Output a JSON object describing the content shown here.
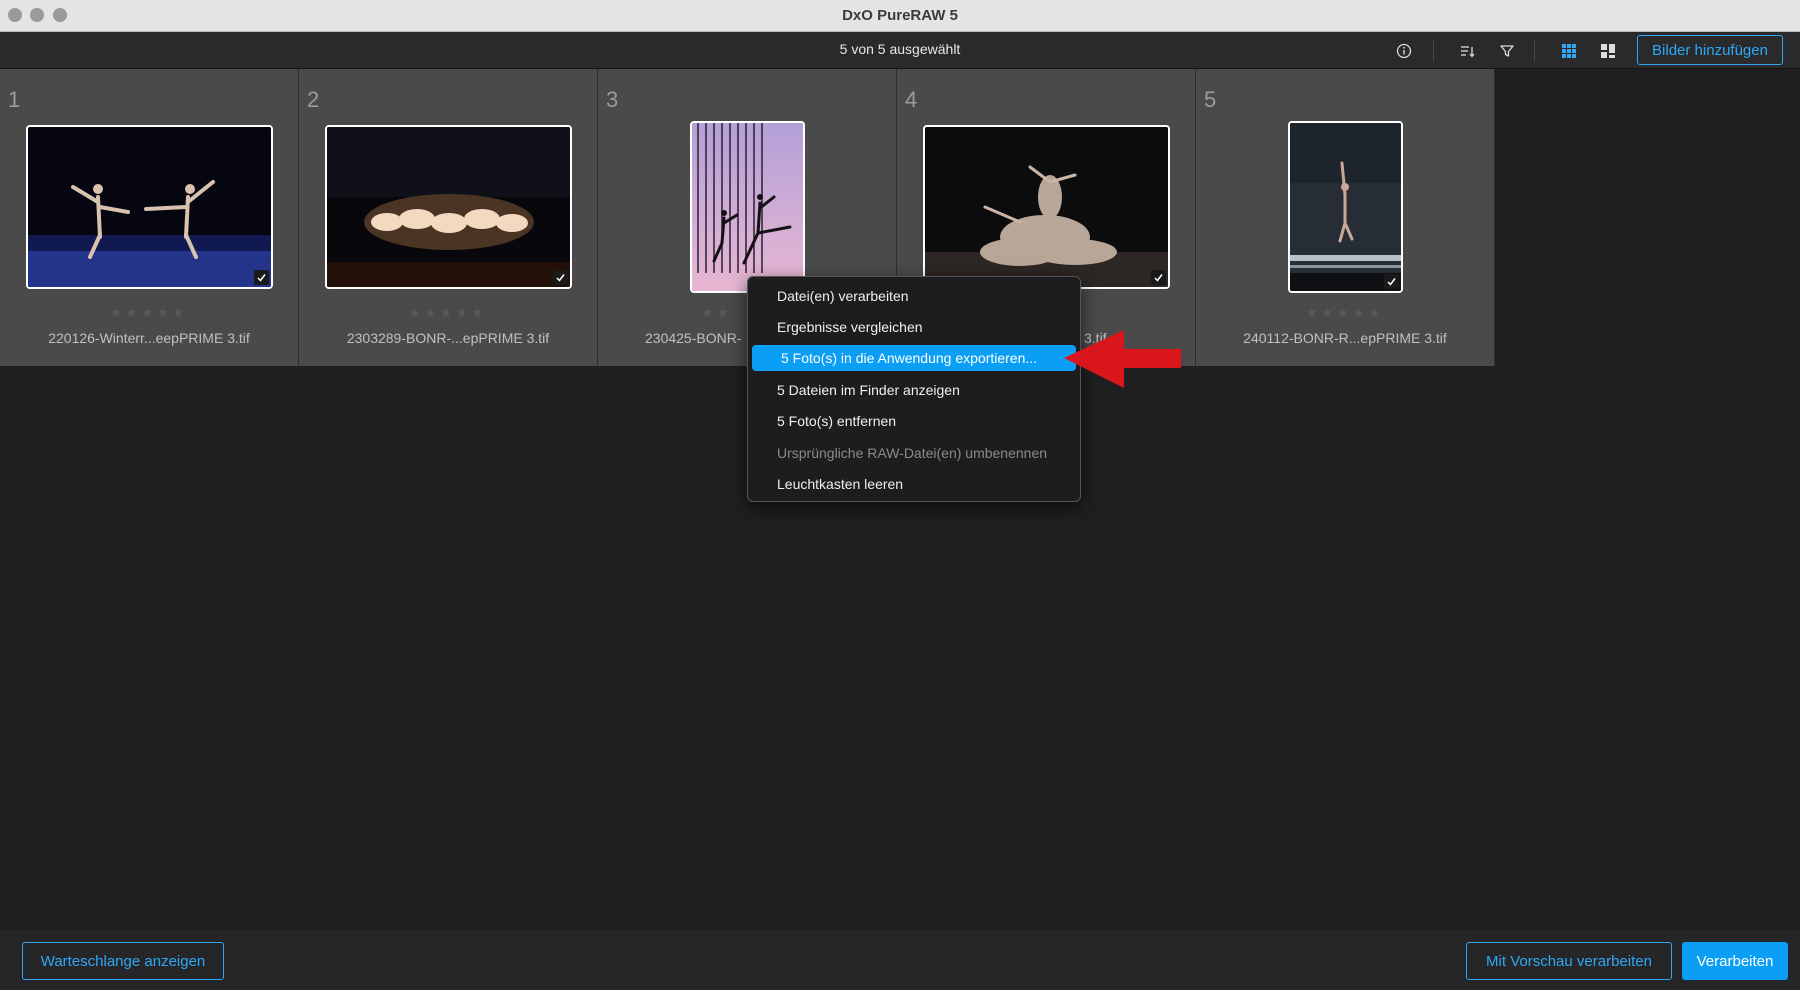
{
  "window": {
    "title": "DxO PureRAW 5"
  },
  "toolbar": {
    "selection_status": "5 von 5 ausgewählt",
    "icons": [
      "info-icon",
      "sort-icon",
      "filter-icon",
      "grid-view-icon",
      "compare-view-icon"
    ],
    "add_images_label": "Bilder hinzufügen"
  },
  "photos": [
    {
      "index": "1",
      "filename": "220126-Winterr...eepPRIME 3.tif",
      "stars": "★★★★★",
      "rating": 0,
      "selected": true
    },
    {
      "index": "2",
      "filename": "2303289-BONR-...epPRIME 3.tif",
      "stars": "★★★★★",
      "rating": 0,
      "selected": true
    },
    {
      "index": "3",
      "filename": "230425-BONR-",
      "stars": "★★",
      "rating": 0,
      "selected": true
    },
    {
      "index": "4",
      "filename": "3.tif",
      "stars": "",
      "rating": 0,
      "selected": true
    },
    {
      "index": "5",
      "filename": "240112-BONR-R...epPRIME 3.tif",
      "stars": "★★★★★",
      "rating": 0,
      "selected": true
    }
  ],
  "context_menu": {
    "items": [
      {
        "label": "Datei(en) verarbeiten",
        "state": "normal"
      },
      {
        "label": "Ergebnisse vergleichen",
        "state": "normal"
      },
      {
        "label": "5 Foto(s) in die Anwendung exportieren...",
        "state": "highlighted"
      },
      {
        "label": "5 Dateien im Finder anzeigen",
        "state": "normal"
      },
      {
        "label": "5 Foto(s) entfernen",
        "state": "normal"
      },
      {
        "label": "Ursprüngliche RAW-Datei(en) umbenennen",
        "state": "disabled"
      },
      {
        "label": "Leuchtkasten leeren",
        "state": "normal"
      }
    ]
  },
  "annotation": {
    "arrow_color": "#d9161c"
  },
  "bottom": {
    "queue_label": "Warteschlange anzeigen",
    "preview_process_label": "Mit Vorschau verarbeiten",
    "process_label": "Verarbeiten"
  },
  "colors": {
    "accent": "#0a9ff5",
    "accent_outline": "#2ea8f5"
  }
}
